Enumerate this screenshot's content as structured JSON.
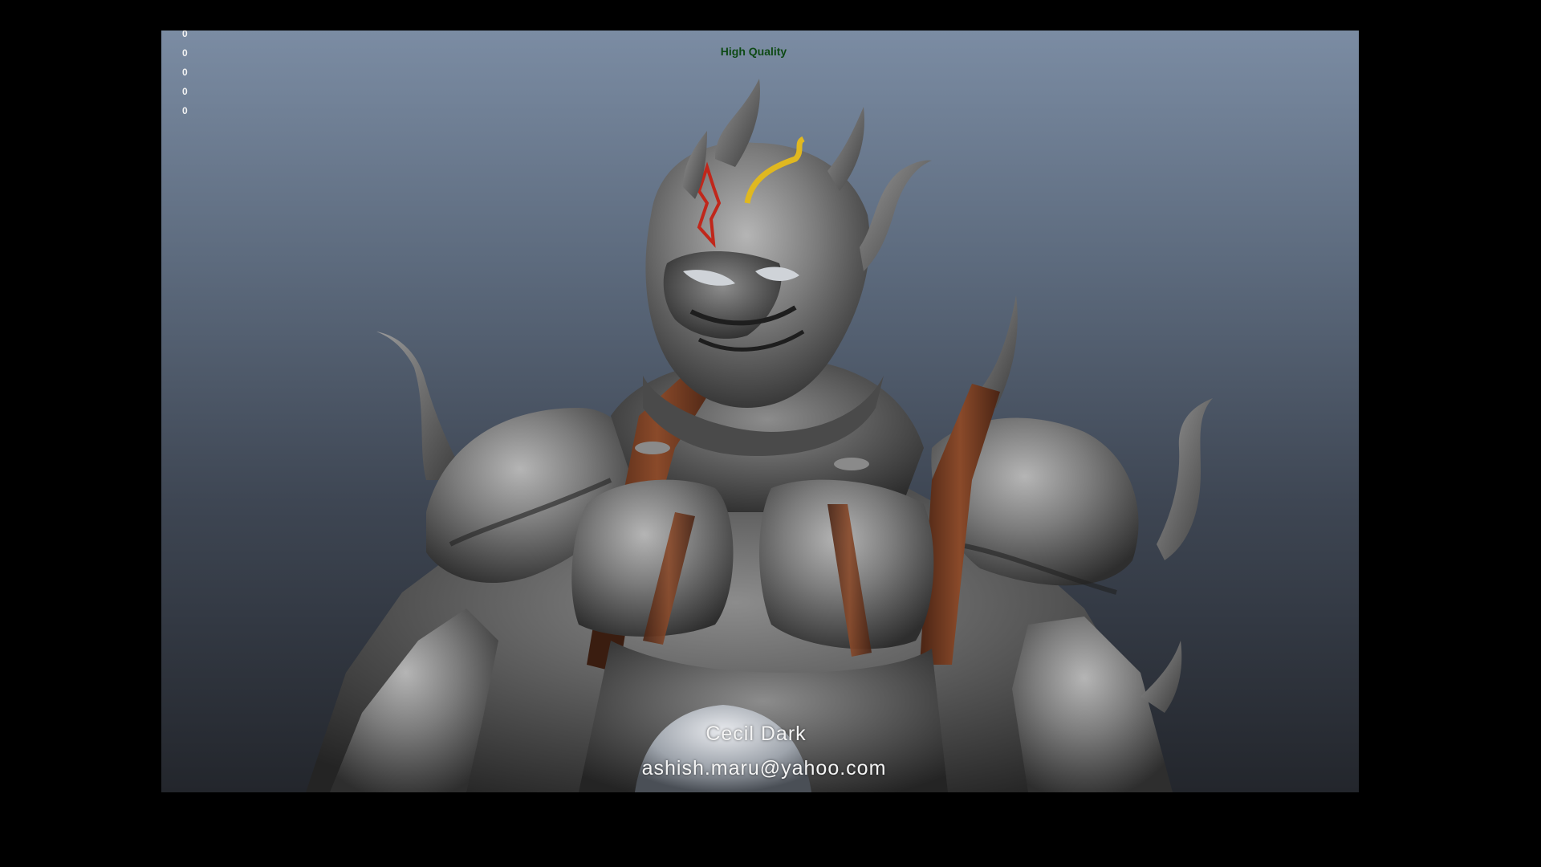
{
  "viewport": {
    "hud_values": [
      "0",
      "0",
      "0",
      "0",
      "0"
    ],
    "quality_label": "High Quality",
    "caption_title": "Cecil Dark",
    "caption_email": "ashish.maru@yahoo.com"
  },
  "colors": {
    "background": "#000000",
    "viewport_top": "#7b8ca3",
    "viewport_bottom": "#23262c",
    "quality_label": "#0e4a15",
    "armor_metal": "#8a8a8a",
    "leather_strap": "#6b3a22",
    "helmet_red_mark": "#c0271b",
    "helmet_yellow_mark": "#e0b820"
  },
  "icons": {
    "render": "armored-character-render"
  }
}
